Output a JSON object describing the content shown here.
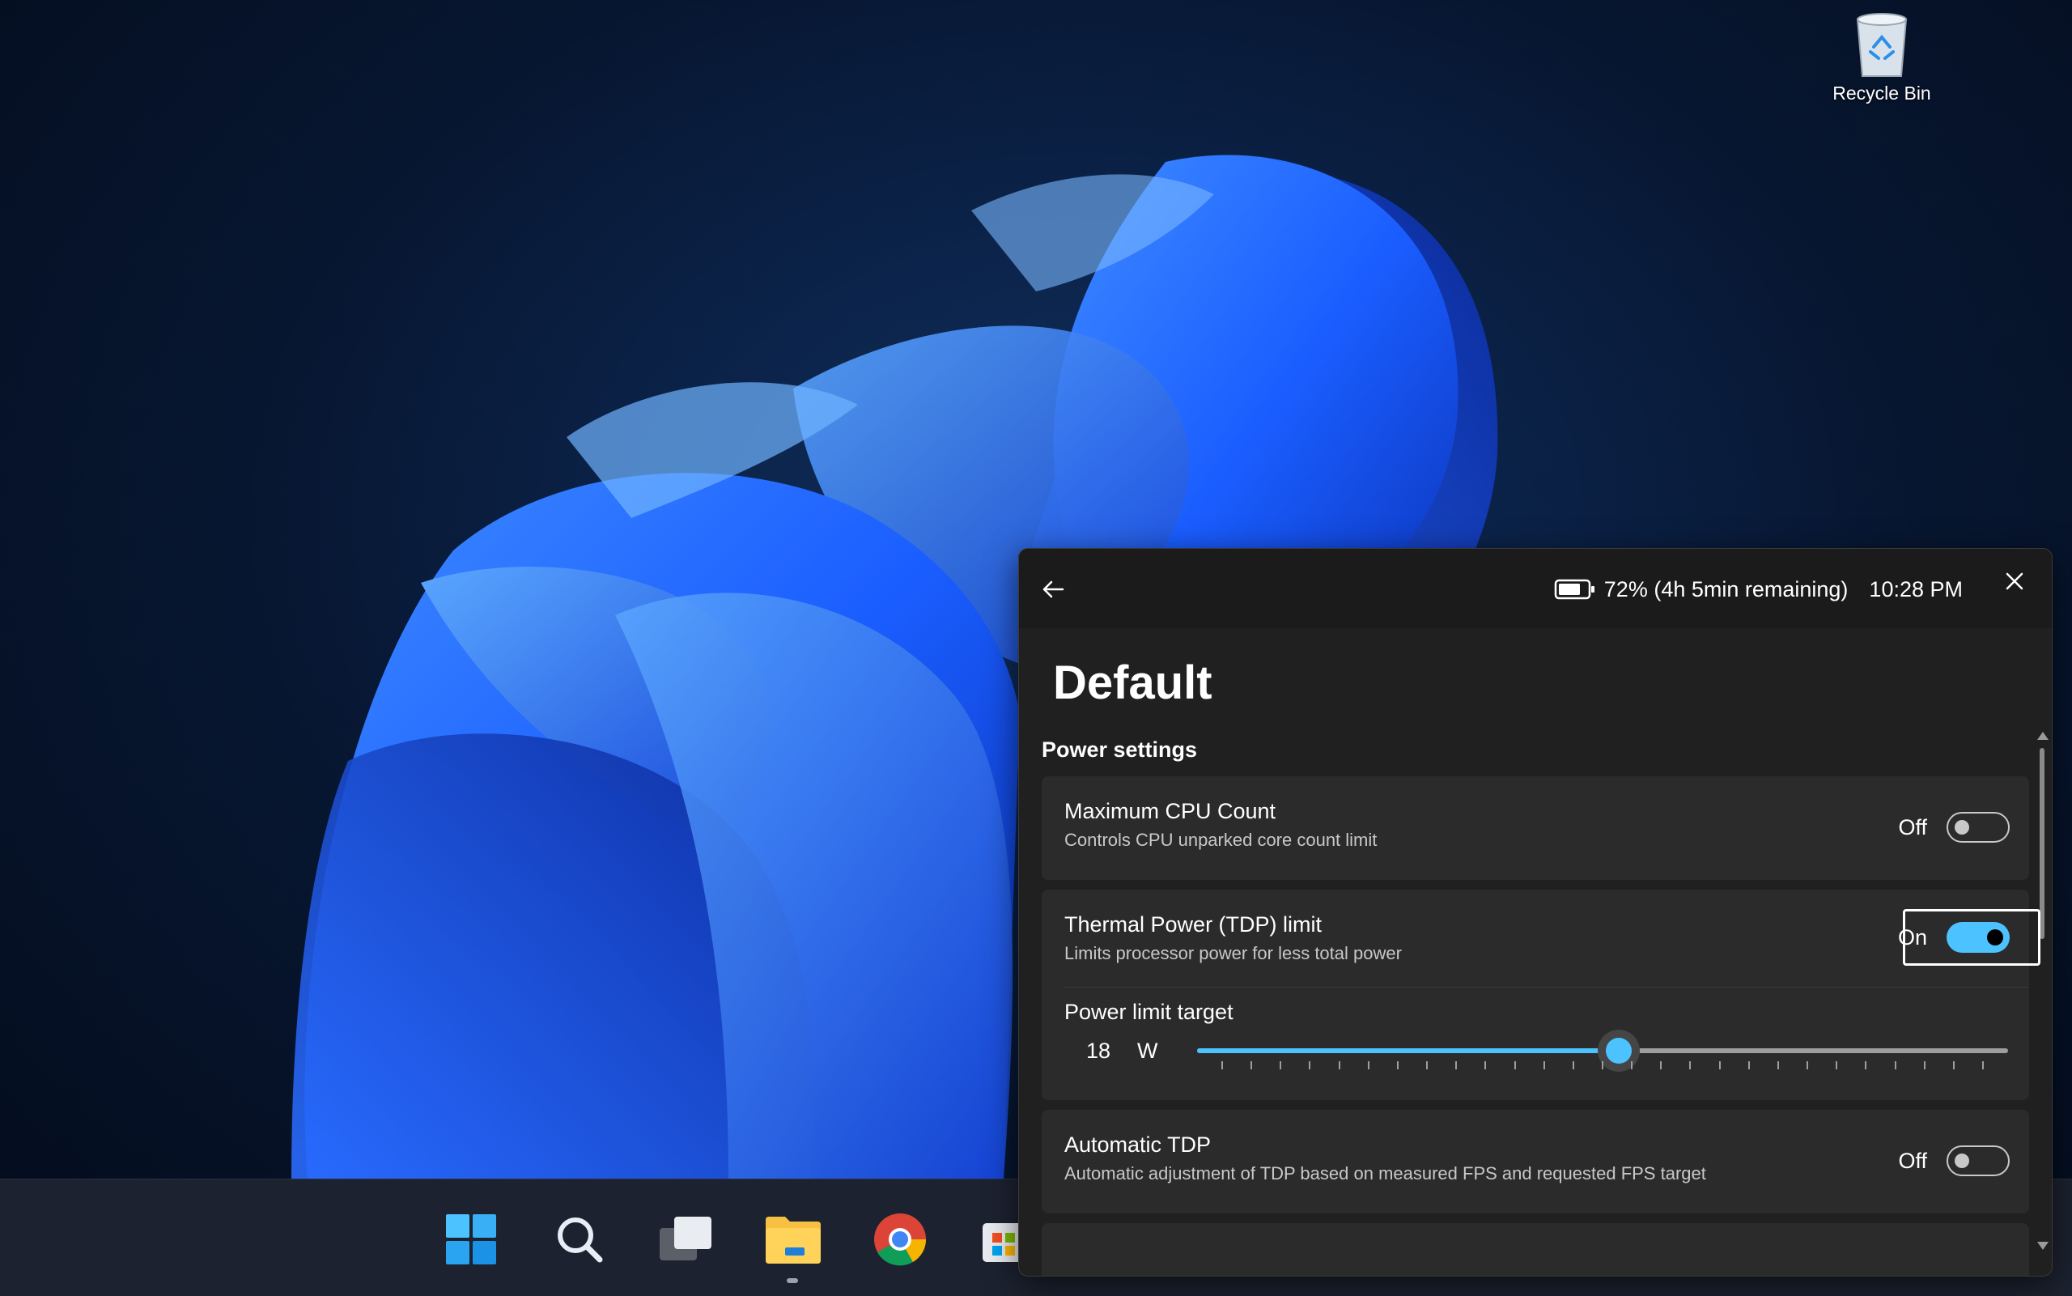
{
  "desktop": {
    "recycle_bin_label": "Recycle Bin"
  },
  "taskbar": {
    "icons": [
      "windows-start-icon",
      "search-icon",
      "task-view-icon",
      "file-explorer-icon",
      "chrome-icon",
      "store-icon"
    ]
  },
  "panel": {
    "battery_text": "72% (4h 5min remaining)",
    "time": "10:28 PM",
    "title": "Default",
    "section_title": "Power settings",
    "max_cpu": {
      "title": "Maximum CPU Count",
      "description": "Controls CPU unparked core count limit",
      "state": "Off"
    },
    "tdp": {
      "title": "Thermal Power (TDP) limit",
      "description": "Limits processor power for less total power",
      "state": "On"
    },
    "power_limit": {
      "title": "Power limit target",
      "value": "18",
      "unit": "W",
      "fraction": 0.52,
      "tick_count": 27
    },
    "auto_tdp": {
      "title": "Automatic TDP",
      "description": "Automatic adjustment of TDP based on measured FPS and requested FPS target",
      "state": "Off"
    }
  },
  "colors": {
    "accent": "#4cc2ff",
    "panel_bg": "#202020",
    "card_bg": "#2b2b2b"
  }
}
